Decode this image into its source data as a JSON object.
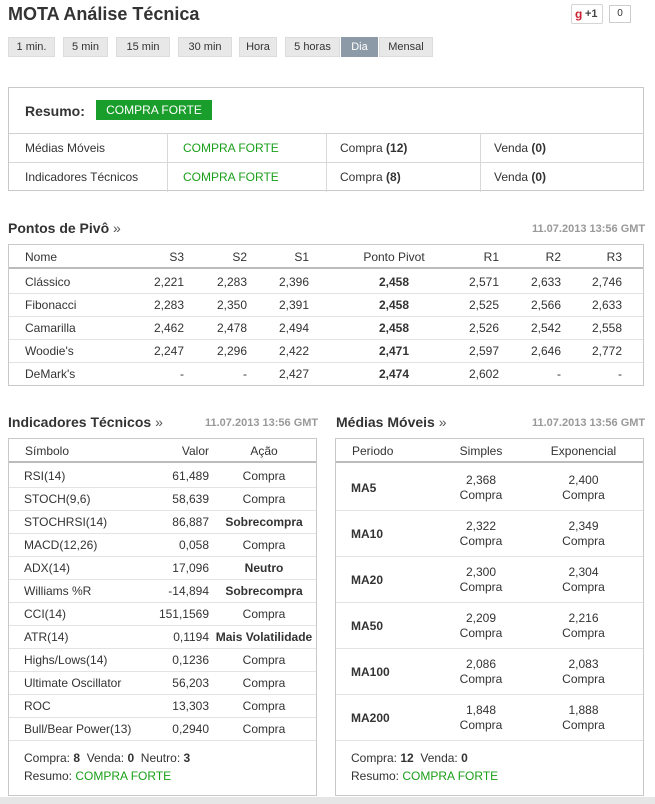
{
  "title": "MOTA Análise Técnica",
  "social": {
    "gplus_g": "g",
    "gplus_label": "+1",
    "count": "0"
  },
  "timeframes": [
    "1 min.",
    "5 min",
    "15 min",
    "30 min",
    "Hora",
    "5 horas",
    "Dia",
    "Mensal"
  ],
  "active_timeframe": "Dia",
  "summary": {
    "label": "Resumo:",
    "value": "COMPRA FORTE",
    "rows": [
      {
        "name": "Médias Móveis",
        "signal": "COMPRA FORTE",
        "buy_label": "Compra",
        "buy": "(12)",
        "sell_label": "Venda",
        "sell": "(0)"
      },
      {
        "name": "Indicadores Técnicos",
        "signal": "COMPRA FORTE",
        "buy_label": "Compra",
        "buy": "(8)",
        "sell_label": "Venda",
        "sell": "(0)"
      }
    ]
  },
  "pivot": {
    "title": "Pontos de Pivô",
    "arrow": "»",
    "timestamp": "11.07.2013 13:56 GMT",
    "headers": [
      "Nome",
      "S3",
      "S2",
      "S1",
      "Ponto Pivot",
      "R1",
      "R2",
      "R3"
    ],
    "rows": [
      [
        "Clássico",
        "2,221",
        "2,283",
        "2,396",
        "2,458",
        "2,571",
        "2,633",
        "2,746"
      ],
      [
        "Fibonacci",
        "2,283",
        "2,350",
        "2,391",
        "2,458",
        "2,525",
        "2,566",
        "2,633"
      ],
      [
        "Camarilla",
        "2,462",
        "2,478",
        "2,494",
        "2,458",
        "2,526",
        "2,542",
        "2,558"
      ],
      [
        "Woodie's",
        "2,247",
        "2,296",
        "2,422",
        "2,471",
        "2,597",
        "2,646",
        "2,772"
      ],
      [
        "DeMark's",
        "-",
        "-",
        "2,427",
        "2,474",
        "2,602",
        "-",
        "-"
      ]
    ]
  },
  "indicators": {
    "title": "Indicadores Técnicos",
    "arrow": "»",
    "timestamp": "11.07.2013 13:56 GMT",
    "headers": [
      "Símbolo",
      "Valor",
      "Ação"
    ],
    "rows": [
      [
        "RSI(14)",
        "61,489",
        "Compra"
      ],
      [
        "STOCH(9,6)",
        "58,639",
        "Compra"
      ],
      [
        "STOCHRSI(14)",
        "86,887",
        "Sobrecompra"
      ],
      [
        "MACD(12,26)",
        "0,058",
        "Compra"
      ],
      [
        "ADX(14)",
        "17,096",
        "Neutro"
      ],
      [
        "Williams %R",
        "-14,894",
        "Sobrecompra"
      ],
      [
        "CCI(14)",
        "151,1569",
        "Compra"
      ],
      [
        "ATR(14)",
        "0,1194",
        "Mais Volatilidade"
      ],
      [
        "Highs/Lows(14)",
        "0,1236",
        "Compra"
      ],
      [
        "Ultimate Oscillator",
        "56,203",
        "Compra"
      ],
      [
        "ROC",
        "13,303",
        "Compra"
      ],
      [
        "Bull/Bear Power(13)",
        "0,2940",
        "Compra"
      ]
    ],
    "footer": {
      "buy_label": "Compra:",
      "buy": "8",
      "sell_label": "Venda:",
      "sell": "0",
      "neutral_label": "Neutro:",
      "neutral": "3",
      "summary_label": "Resumo:",
      "summary": "COMPRA FORTE"
    }
  },
  "moving_averages": {
    "title": "Médias Móveis",
    "arrow": "»",
    "timestamp": "11.07.2013 13:56 GMT",
    "headers": [
      "Periodo",
      "Simples",
      "Exponencial"
    ],
    "rows": [
      {
        "period": "MA5",
        "simple": "2,368",
        "simple_action": "Compra",
        "exp": "2,400",
        "exp_action": "Compra"
      },
      {
        "period": "MA10",
        "simple": "2,322",
        "simple_action": "Compra",
        "exp": "2,349",
        "exp_action": "Compra"
      },
      {
        "period": "MA20",
        "simple": "2,300",
        "simple_action": "Compra",
        "exp": "2,304",
        "exp_action": "Compra"
      },
      {
        "period": "MA50",
        "simple": "2,209",
        "simple_action": "Compra",
        "exp": "2,216",
        "exp_action": "Compra"
      },
      {
        "period": "MA100",
        "simple": "2,086",
        "simple_action": "Compra",
        "exp": "2,083",
        "exp_action": "Compra"
      },
      {
        "period": "MA200",
        "simple": "1,848",
        "simple_action": "Compra",
        "exp": "1,888",
        "exp_action": "Compra"
      }
    ],
    "footer": {
      "buy_label": "Compra:",
      "buy": "12",
      "sell_label": "Venda:",
      "sell": "0",
      "summary_label": "Resumo:",
      "summary": "COMPRA FORTE"
    }
  },
  "colors": {
    "buy": "#1ba01b",
    "badge": "#1a9e2b",
    "active_tab": "#8b9aa6",
    "neutral": "#333333"
  }
}
